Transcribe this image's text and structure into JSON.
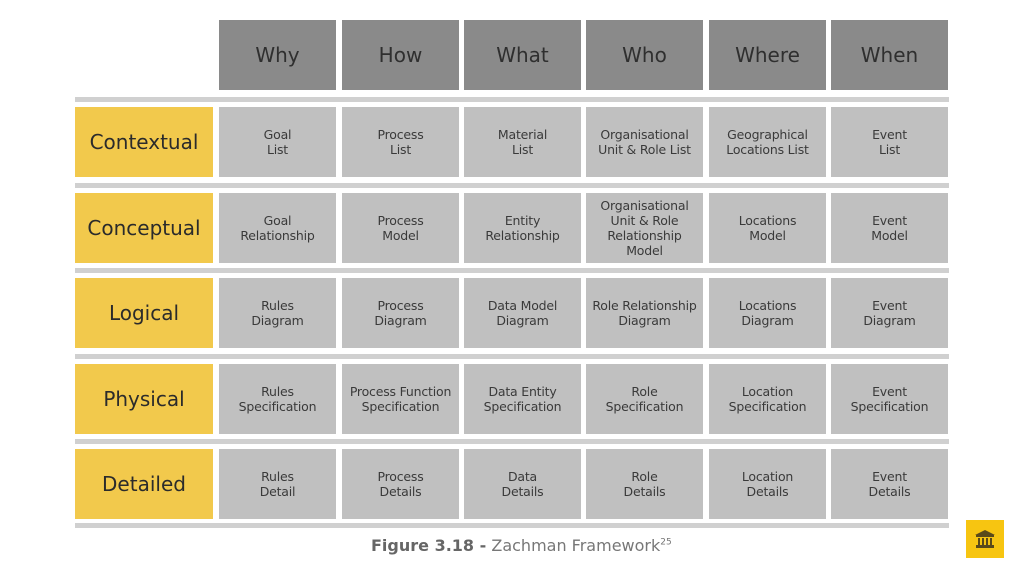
{
  "columns": [
    "Why",
    "How",
    "What",
    "Who",
    "Where",
    "When"
  ],
  "rows": [
    {
      "label": "Contextual",
      "cells": [
        "Goal\nList",
        "Process\nList",
        "Material\nList",
        "Organisational\nUnit & Role List",
        "Geographical\nLocations List",
        "Event\nList"
      ]
    },
    {
      "label": "Conceptual",
      "cells": [
        "Goal\nRelationship",
        "Process\nModel",
        "Entity\nRelationship",
        "Organisational\nUnit & Role\nRelationship\nModel",
        "Locations\nModel",
        "Event\nModel"
      ]
    },
    {
      "label": "Logical",
      "cells": [
        "Rules\nDiagram",
        "Process\nDiagram",
        "Data Model\nDiagram",
        "Role Relationship\nDiagram",
        "Locations\nDiagram",
        "Event\nDiagram"
      ]
    },
    {
      "label": "Physical",
      "cells": [
        "Rules\nSpecification",
        "Process Function\nSpecification",
        "Data Entity\nSpecification",
        "Role\nSpecification",
        "Location\nSpecification",
        "Event\nSpecification"
      ]
    },
    {
      "label": "Detailed",
      "cells": [
        "Rules\nDetail",
        "Process\nDetails",
        "Data\nDetails",
        "Role\nDetails",
        "Location\nDetails",
        "Event\nDetails"
      ]
    }
  ],
  "caption": {
    "figure": "Figure 3.18 -",
    "title": "Zachman Framework",
    "footnote": "25"
  },
  "badge_icon": "institution-icon",
  "colors": {
    "header": "#8a8a8a",
    "row_label": "#f2c94c",
    "cell": "#c0c0c0",
    "separator": "#d0d0d0",
    "badge": "#f7c511"
  }
}
